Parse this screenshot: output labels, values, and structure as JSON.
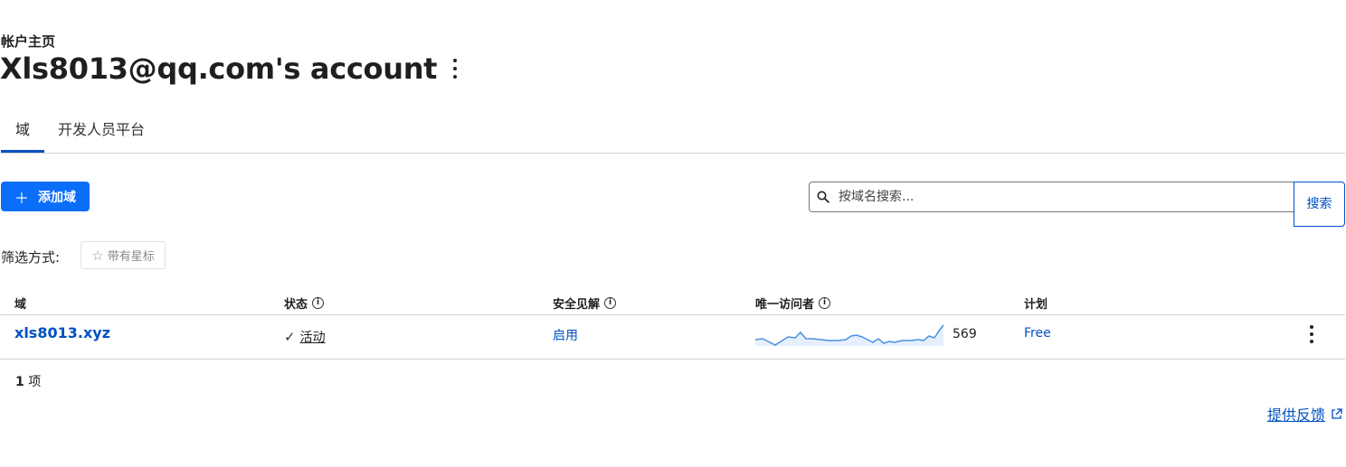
{
  "header": {
    "breadcrumb": "帐户主页",
    "title": "Xls8013@qq.com's account"
  },
  "tabs": [
    {
      "label": "域",
      "active": true
    },
    {
      "label": "开发人员平台",
      "active": false
    }
  ],
  "toolbar": {
    "add_domain_label": "添加域",
    "search_placeholder": "按域名搜索...",
    "search_button_label": "搜索"
  },
  "filter": {
    "label": "筛选方式:",
    "starred_label": "带有星标"
  },
  "table": {
    "columns": [
      "域",
      "状态",
      "安全见解",
      "唯一访问者",
      "计划"
    ],
    "rows": [
      {
        "domain": "xls8013.xyz",
        "status": "活动",
        "security": "启用",
        "visitors": "569",
        "plan": "Free"
      }
    ]
  },
  "footer": {
    "count_number": "1",
    "count_unit": "项",
    "feedback_label": "提供反馈"
  },
  "colors": {
    "accent": "#0051c3",
    "primary_button": "#0a6efa"
  },
  "icons": [
    "kebab-menu-icon",
    "plus-icon",
    "search-icon",
    "star-icon",
    "info-icon",
    "check-icon",
    "external-link-icon"
  ]
}
